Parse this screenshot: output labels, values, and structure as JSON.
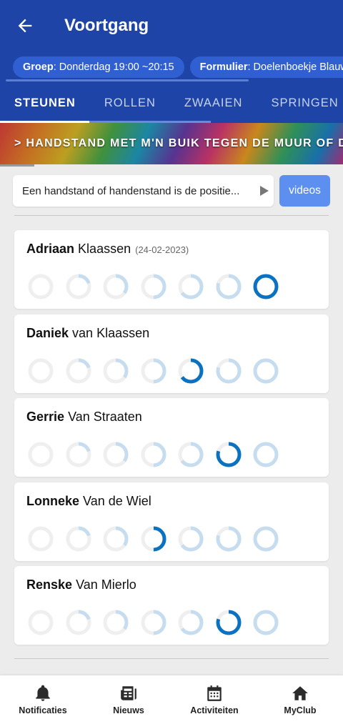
{
  "appbar": {
    "title": "Voortgang"
  },
  "chips": [
    {
      "key": "Groep",
      "value": ": Donderdag 19:00 ~20:15"
    },
    {
      "key": "Formulier",
      "value": ": Doelenboekje Blauw"
    }
  ],
  "tabs": [
    "STEUNEN",
    "ROLLEN",
    "ZWAAIEN",
    "SPRINGEN"
  ],
  "banner": {
    "text": "> HANDSTAND MET M'N BUIK TEGEN DE MUUR OF DE WAND"
  },
  "description": {
    "text": "Een handstand of handenstand is de positie...",
    "videos_label": "videos"
  },
  "colors": {
    "primary": "#1f44a8",
    "ring_light": "#c6dcef",
    "ring_empty": "#efefef",
    "ring_active": "#0a72c0"
  },
  "students": [
    {
      "first": "Adriaan",
      "last": "Klaassen",
      "date": "(24-02-2023)",
      "levels": [
        0,
        0.2,
        0.35,
        0.5,
        0.65,
        0.8,
        1.0
      ],
      "active": 6
    },
    {
      "first": "Daniek",
      "last": "van Klaassen",
      "date": "",
      "levels": [
        0,
        0.2,
        0.35,
        0.5,
        0.65,
        0.8,
        1.0
      ],
      "active": 4
    },
    {
      "first": "Gerrie",
      "last": "Van Straaten",
      "date": "",
      "levels": [
        0,
        0.2,
        0.35,
        0.5,
        0.65,
        0.8,
        1.0
      ],
      "active": 5
    },
    {
      "first": "Lonneke",
      "last": "Van de Wiel",
      "date": "",
      "levels": [
        0,
        0.2,
        0.35,
        0.5,
        0.65,
        0.8,
        1.0
      ],
      "active": 3
    },
    {
      "first": "Renske",
      "last": "Van Mierlo",
      "date": "",
      "levels": [
        0,
        0.2,
        0.35,
        0.5,
        0.65,
        0.8,
        1.0
      ],
      "active": 5
    }
  ],
  "nav": [
    {
      "label": "Notificaties",
      "icon": "bell-icon"
    },
    {
      "label": "Nieuws",
      "icon": "newspaper-icon"
    },
    {
      "label": "Activiteiten",
      "icon": "calendar-icon"
    },
    {
      "label": "MyClub",
      "icon": "home-icon"
    }
  ]
}
